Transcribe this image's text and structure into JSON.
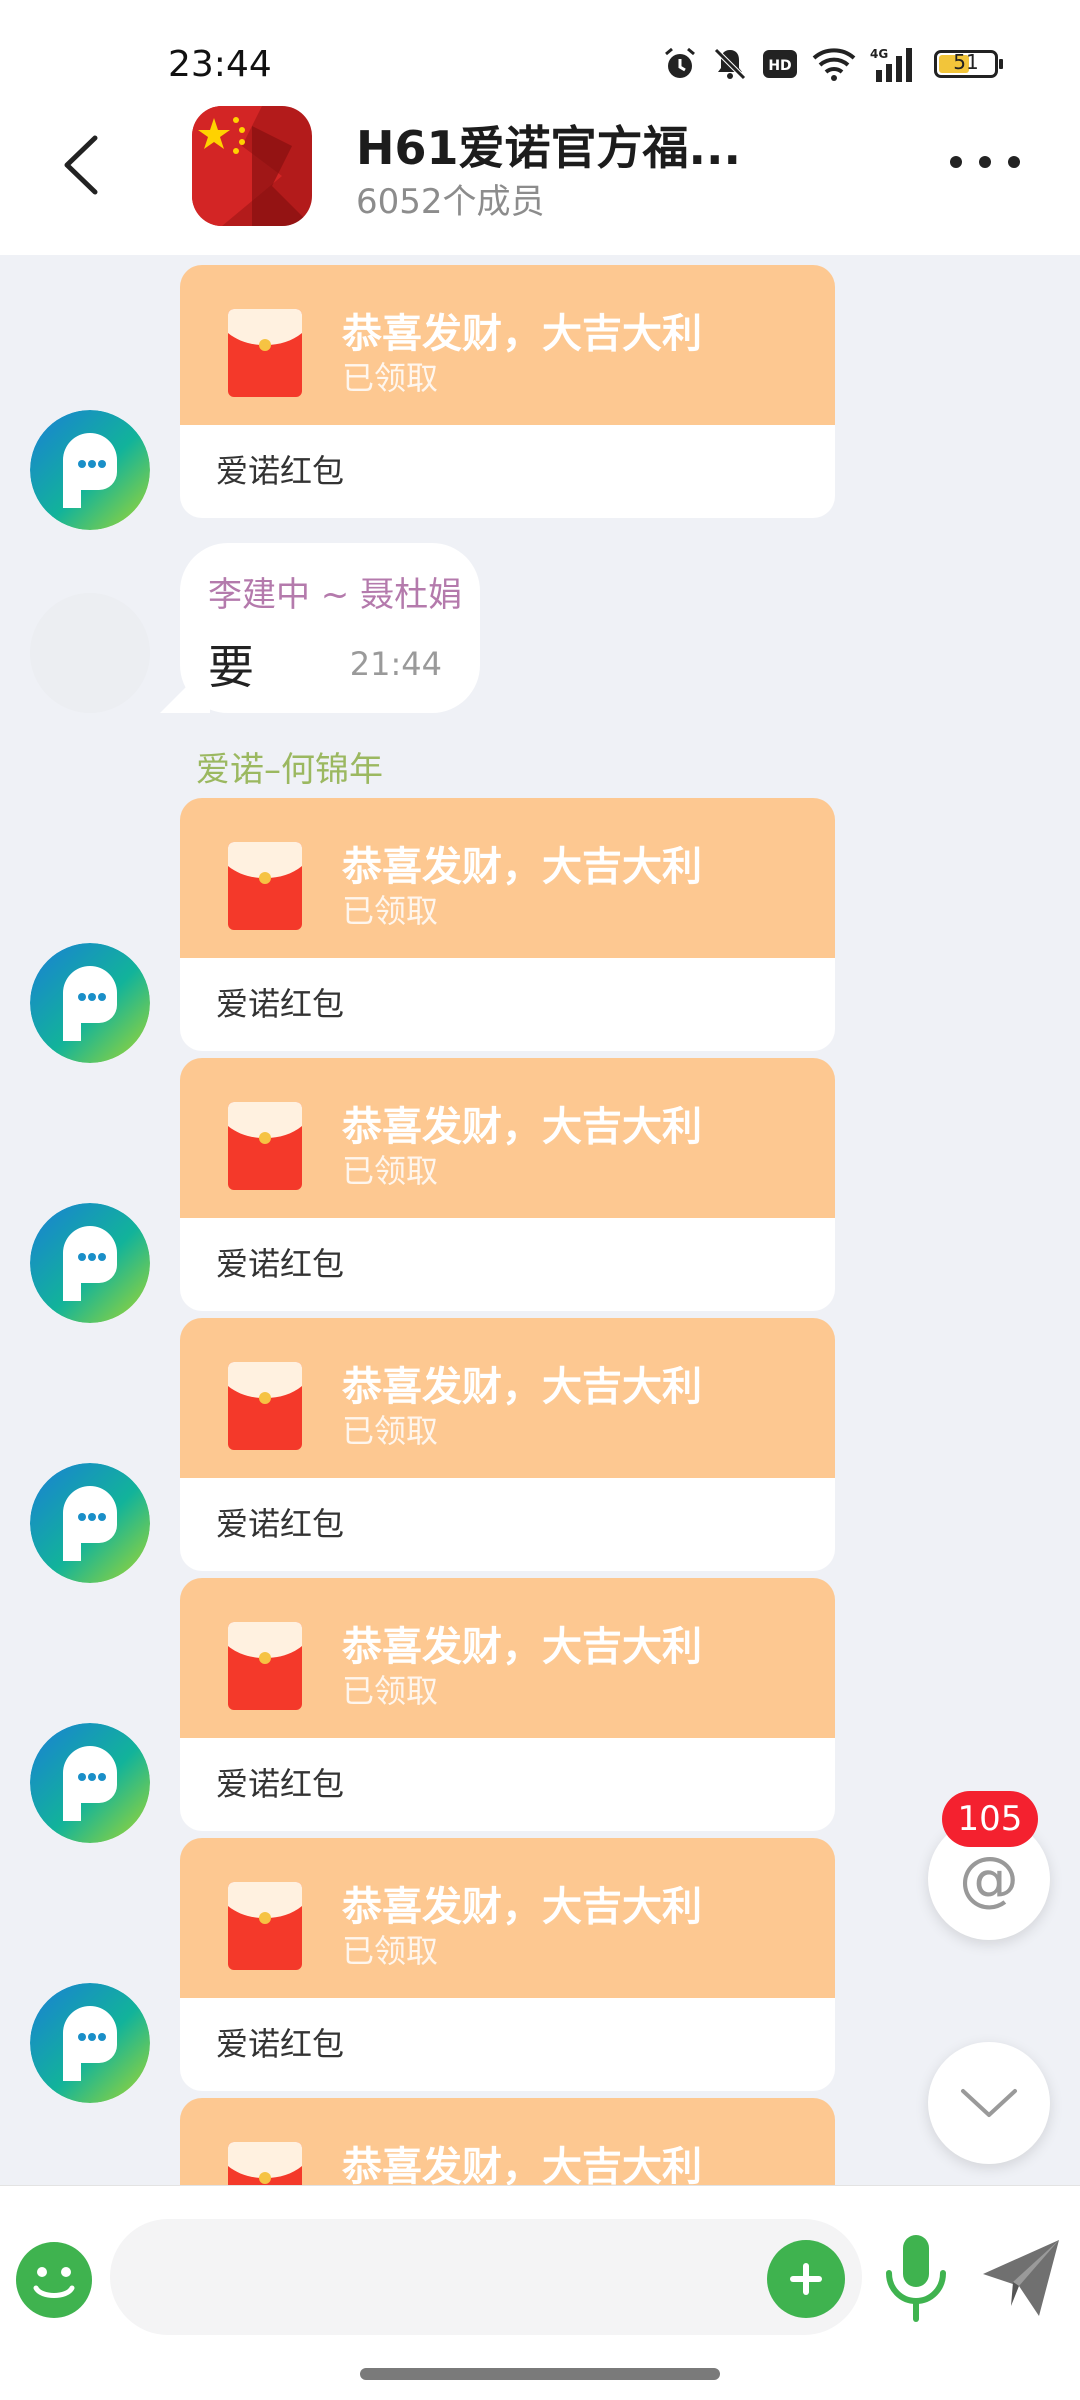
{
  "status_bar": {
    "time": "23:44",
    "battery": "51",
    "network": "4G",
    "hd": "HD",
    "icons": [
      "alarm-icon",
      "mute-icon",
      "hd-icon",
      "wifi-icon",
      "signal-icon",
      "battery-icon"
    ]
  },
  "header": {
    "title": "H61爱诺官方福...",
    "member_count": "6052个成员"
  },
  "messages": {
    "rp0": {
      "title": "恭喜发财，大吉大利",
      "status": "已领取",
      "footer": "爱诺红包"
    },
    "text1": {
      "sender": "李建中 ~ 聂杜娟",
      "text": "要",
      "time": "21:44"
    },
    "sender2": "爱诺–何锦年",
    "rp2": {
      "title": "恭喜发财，大吉大利",
      "status": "已领取",
      "footer": "爱诺红包"
    },
    "rp3": {
      "title": "恭喜发财，大吉大利",
      "status": "已领取",
      "footer": "爱诺红包"
    },
    "rp4": {
      "title": "恭喜发财，大吉大利",
      "status": "已领取",
      "footer": "爱诺红包"
    },
    "rp5": {
      "title": "恭喜发财，大吉大利",
      "status": "已领取",
      "footer": "爱诺红包"
    },
    "rp6": {
      "title": "恭喜发财，大吉大利",
      "status": "已领取",
      "footer": "爱诺红包"
    },
    "rp7": {
      "title": "恭喜发财，大吉大利"
    }
  },
  "floating": {
    "mention_count": "105",
    "mention_symbol": "@"
  },
  "colors": {
    "red_packet": "#fdc891",
    "send_green": "#3fb34f",
    "badge_red": "#f4212f",
    "sender_green": "#9bb860",
    "sender_purple": "#b47aac"
  }
}
